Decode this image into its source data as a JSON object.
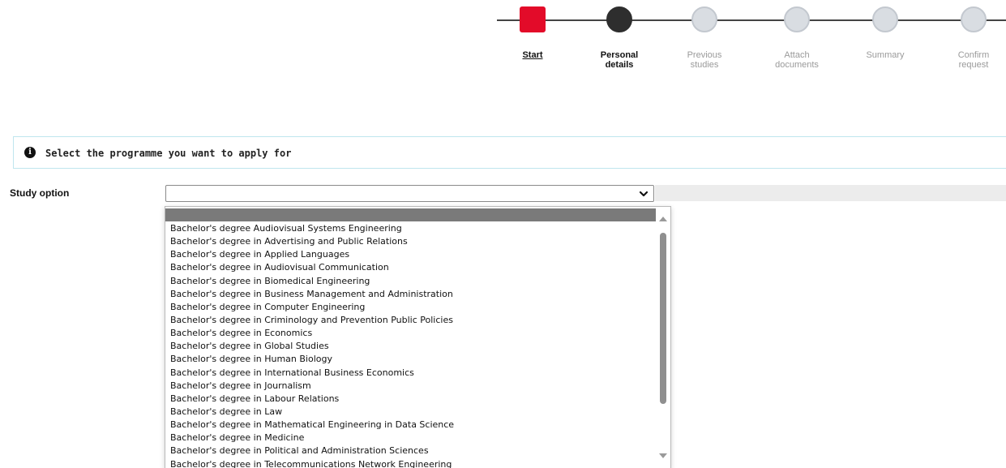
{
  "stepper": {
    "steps": [
      {
        "label": "Start",
        "state": "current"
      },
      {
        "label": "Personal\ndetails",
        "state": "done"
      },
      {
        "label": "Previous\nstudies",
        "state": "todo"
      },
      {
        "label": "Attach\ndocuments",
        "state": "todo"
      },
      {
        "label": "Summary",
        "state": "todo"
      },
      {
        "label": "Confirm\nrequest",
        "state": "todo"
      }
    ]
  },
  "info": {
    "icon": "info-icon",
    "text": "Select the programme you want to apply for"
  },
  "form": {
    "study_option_label": "Study option",
    "study_option_value": "",
    "chevron_icon": "chevron-down-icon"
  },
  "dropdown": {
    "options": [
      "",
      "Bachelor's degree Audiovisual Systems Engineering",
      "Bachelor's degree in Advertising and Public Relations",
      "Bachelor's degree in Applied Languages",
      "Bachelor's degree in Audiovisual Communication",
      "Bachelor's degree in Biomedical Engineering",
      "Bachelor's degree in Business Management and Administration",
      "Bachelor's degree in Computer Engineering",
      "Bachelor's degree in Criminology and Prevention Public Policies",
      "Bachelor's degree in Economics",
      "Bachelor's degree in Global Studies",
      "Bachelor's degree in Human Biology",
      "Bachelor's degree in International Business Economics",
      "Bachelor's degree in Journalism",
      "Bachelor's degree in Labour Relations",
      "Bachelor's degree in Law",
      "Bachelor's degree in Mathematical Engineering in Data Science",
      "Bachelor's degree in Medicine",
      "Bachelor's degree in Political and Administration Sciences",
      "Bachelor's degree in Telecommunications Network Engineering"
    ]
  },
  "colors": {
    "accent": "#e30b29",
    "done": "#2e2e2e",
    "pending": "#d9dde2",
    "info_border": "#bfe6ee"
  }
}
